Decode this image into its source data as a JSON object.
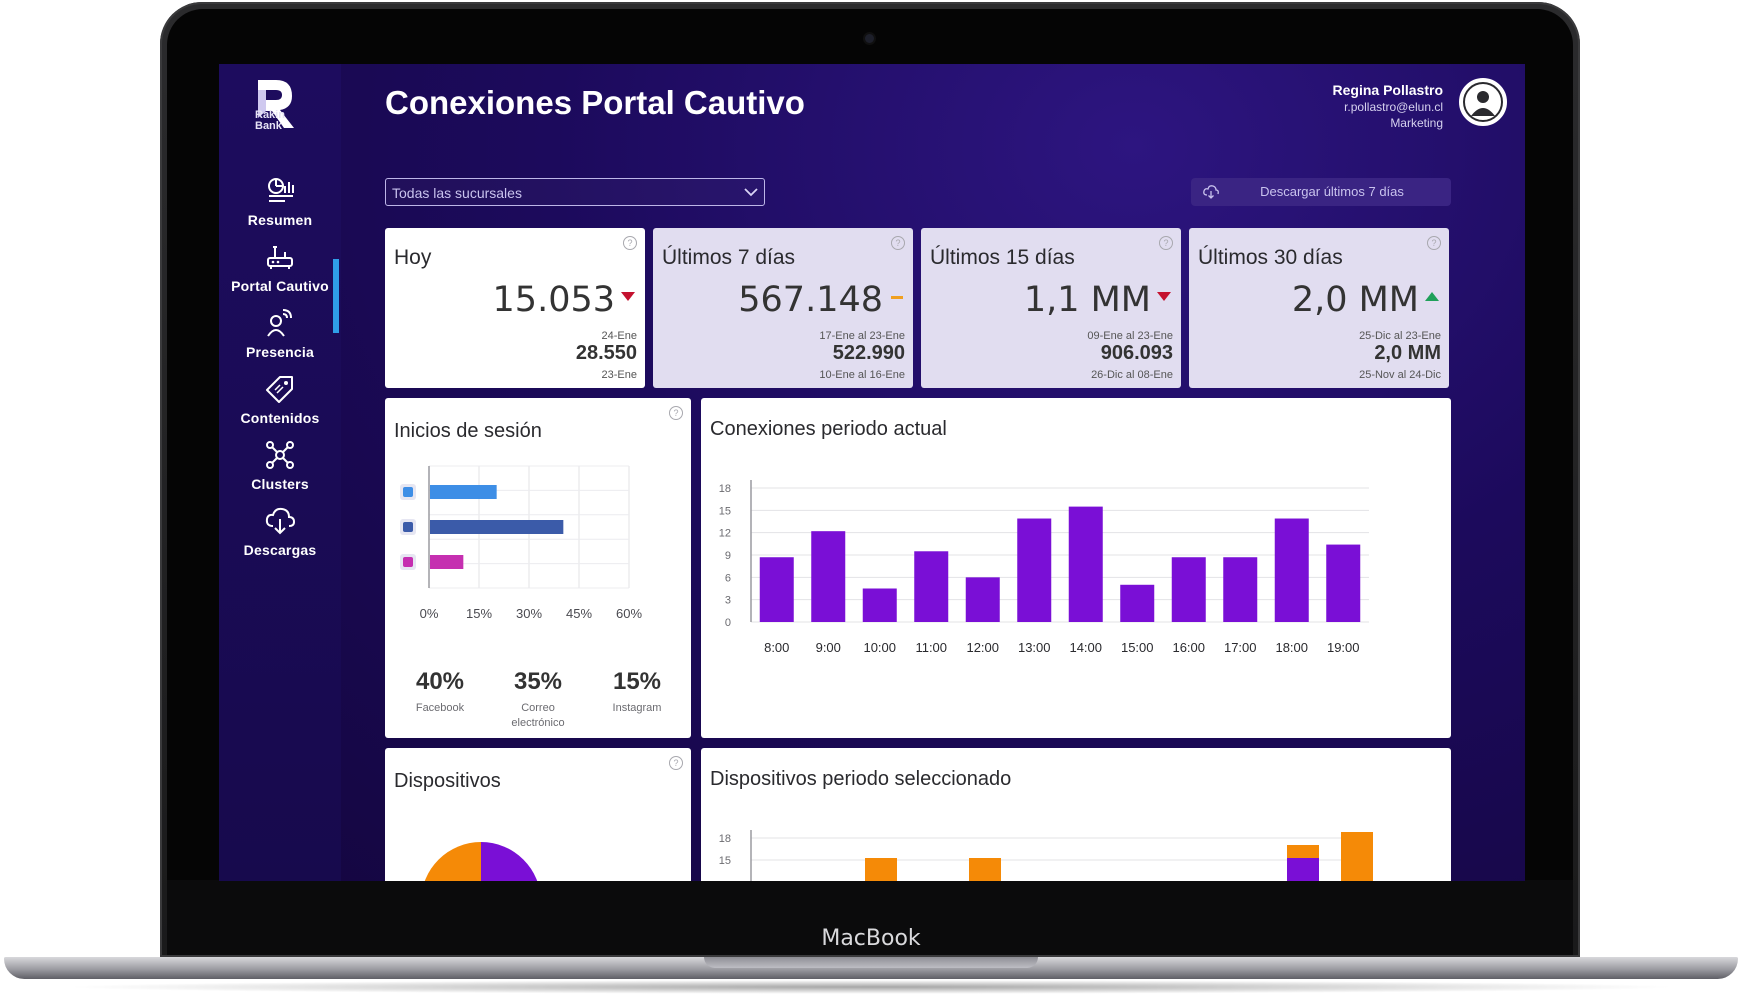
{
  "device": {
    "brand": "MacBook"
  },
  "app": {
    "logo_text_line1": "Rakin",
    "logo_text_line2": "Bank",
    "page_title": "Conexiones Portal Cautivo"
  },
  "user": {
    "name": "Regina Pollastro",
    "email": "r.pollastro@elun.cl",
    "department": "Marketing"
  },
  "sidebar": {
    "items": [
      {
        "label": "Resumen",
        "icon": "summary-chart-icon",
        "active": false
      },
      {
        "label": "Portal Cautivo",
        "icon": "router-icon",
        "active": true
      },
      {
        "label": "Presencia",
        "icon": "person-signal-icon",
        "active": false
      },
      {
        "label": "Contenidos",
        "icon": "tag-icon",
        "active": false
      },
      {
        "label": "Clusters",
        "icon": "network-icon",
        "active": false
      },
      {
        "label": "Descargas",
        "icon": "cloud-download-icon",
        "active": false
      }
    ]
  },
  "filters": {
    "branch_select_value": "Todas las sucursales",
    "download_label": "Descargar últimos 7 días"
  },
  "kpis": [
    {
      "title": "Hoy",
      "value": "15.053",
      "trend": "down",
      "value_date": "24-Ene",
      "previous": "28.550",
      "previous_date": "23-Ene"
    },
    {
      "title": "Últimos 7 días",
      "value": "567.148",
      "trend": "flat",
      "value_date": "17-Ene al 23-Ene",
      "previous": "522.990",
      "previous_date": "10-Ene al 16-Ene"
    },
    {
      "title": "Últimos 15 días",
      "value": "1,1 MM",
      "trend": "down",
      "value_date": "09-Ene al  23-Ene",
      "previous": "906.093",
      "previous_date": "26-Dic al 08-Ene"
    },
    {
      "title": "Últimos 30 días",
      "value": "2,0 MM",
      "trend": "up",
      "value_date": "25-Dic al 23-Ene",
      "previous": "2,0 MM",
      "previous_date": "25-Nov al 24-Dic"
    }
  ],
  "colors": {
    "accent": "#7a0fd6",
    "orange": "#f58a07",
    "trend_down": "#c4122f",
    "trend_up": "#1fa05a",
    "trend_flat": "#f0a020",
    "email": "#3d8ee6",
    "facebook": "#3b5ba9",
    "instagram": "#c52fb0"
  },
  "logins": {
    "title": "Inicios de sesión",
    "summary": [
      {
        "value": "40%",
        "label": "Facebook"
      },
      {
        "value": "35%",
        "label": "Correo electrónico"
      },
      {
        "value": "15%",
        "label": "Instagram"
      }
    ]
  },
  "devices": {
    "title": "Dispositivos"
  },
  "devices_period": {
    "title": "Dispositivos periodo seleccionado"
  },
  "connections": {
    "title": "Conexiones periodo actual"
  },
  "chart_data": [
    {
      "type": "bar",
      "orientation": "horizontal",
      "categories": [
        "email-icon",
        "facebook-icon",
        "instagram-icon"
      ],
      "values": [
        20,
        40,
        10
      ],
      "x_ticks": [
        "0%",
        "15%",
        "30%",
        "45%",
        "60%"
      ],
      "xlim": [
        0,
        60
      ],
      "grid": true
    },
    {
      "type": "bar",
      "title": "Conexiones periodo actual",
      "categories": [
        "8:00",
        "9:00",
        "10:00",
        "11:00",
        "12:00",
        "13:00",
        "14:00",
        "15:00",
        "16:00",
        "17:00",
        "18:00",
        "19:00"
      ],
      "values": [
        8.7,
        12.2,
        4.5,
        9.5,
        6.0,
        13.9,
        15.5,
        5.0,
        8.7,
        8.7,
        13.9,
        10.4
      ],
      "y_ticks": [
        0,
        3,
        6,
        9,
        12,
        15,
        18
      ],
      "ylim": [
        0,
        18
      ],
      "grid": true
    },
    {
      "type": "bar",
      "title": "Dispositivos periodo seleccionado",
      "y_ticks": [
        15,
        18
      ],
      "ylim": [
        0,
        18
      ],
      "grid": true
    },
    {
      "type": "pie",
      "title": "Dispositivos"
    }
  ]
}
